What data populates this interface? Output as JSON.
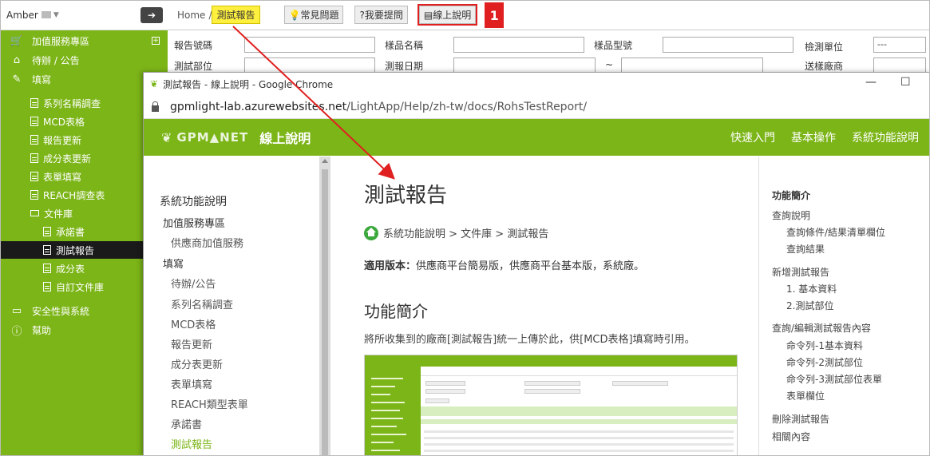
{
  "sidebar": {
    "user": "Amber",
    "items": [
      {
        "label": "加值服務專區",
        "icon": "cart-icon"
      },
      {
        "label": "待辦 / 公告",
        "icon": "home-icon"
      },
      {
        "label": "填寫",
        "icon": "edit-icon"
      },
      {
        "label": "系列名稱調查"
      },
      {
        "label": "MCD表格"
      },
      {
        "label": "報告更新"
      },
      {
        "label": "成分表更新"
      },
      {
        "label": "表單填寫"
      },
      {
        "label": "REACH調查表"
      },
      {
        "label": "文件庫"
      },
      {
        "label": "承諾書"
      },
      {
        "label": "測試報告"
      },
      {
        "label": "成分表"
      },
      {
        "label": "自訂文件庫"
      },
      {
        "label": "安全性與系統",
        "icon": "monitor-icon"
      },
      {
        "label": "幫助",
        "icon": "info-icon"
      }
    ]
  },
  "top": {
    "home": "Home",
    "sep": "/",
    "current": "測試報告",
    "faq": "常見問題",
    "ask": "我要提問",
    "help": "線上說明",
    "badge": "1"
  },
  "form": {
    "report_no": "報告號碼",
    "sample_name": "樣品名稱",
    "sample_model": "樣品型號",
    "test_unit": "檢測單位",
    "test_unit_value": "---",
    "test_part": "測試部位",
    "report_date": "測報日期",
    "tilde": "~",
    "send_factory": "送樣廠商"
  },
  "chrome": {
    "title": "測試報告 - 線上說明 - Google Chrome",
    "url_host": "gpmlight-lab.azurewebsites.net",
    "url_path": "/LightApp/Help/zh-tw/docs/RohsTestReport/"
  },
  "help": {
    "logo": "GPM▲NET",
    "title": "線上說明",
    "nav": [
      "快速入門",
      "基本操作",
      "系統功能說明"
    ],
    "left": {
      "heading": "系統功能說明",
      "items": [
        {
          "label": "加值服務專區",
          "kind": "group"
        },
        {
          "label": "供應商加值服務",
          "kind": "item"
        },
        {
          "label": "填寫",
          "kind": "group"
        },
        {
          "label": "待辦/公告",
          "kind": "item"
        },
        {
          "label": "系列名稱調查",
          "kind": "item"
        },
        {
          "label": "MCD表格",
          "kind": "item"
        },
        {
          "label": "報告更新",
          "kind": "item"
        },
        {
          "label": "成分表更新",
          "kind": "item"
        },
        {
          "label": "表單填寫",
          "kind": "item"
        },
        {
          "label": "REACH類型表單",
          "kind": "item"
        },
        {
          "label": "承諾書",
          "kind": "item"
        },
        {
          "label": "測試報告",
          "kind": "current"
        }
      ]
    },
    "main": {
      "title": "測試報告",
      "path": "系統功能說明 > 文件庫 > 測試報告",
      "ver_label": "適用版本：",
      "ver_value": "供應商平台簡易版，供應商平台基本版，系統廠。",
      "section": "功能簡介",
      "desc": "將所收集到的廠商[測試報告]統一上傳於此，供[MCD表格]填寫時引用。"
    },
    "right": [
      {
        "label": "功能簡介",
        "kind": "h"
      },
      {
        "label": "查詢說明",
        "kind": "a"
      },
      {
        "label": "查詢條件/結果清單欄位",
        "kind": "b"
      },
      {
        "label": "查詢結果",
        "kind": "b"
      },
      {
        "label": "新增測試報告",
        "kind": "a"
      },
      {
        "label": "1. 基本資料",
        "kind": "b"
      },
      {
        "label": "2.測試部位",
        "kind": "b"
      },
      {
        "label": "查詢/編輯測試報告內容",
        "kind": "a"
      },
      {
        "label": "命令列-1基本資料",
        "kind": "b"
      },
      {
        "label": "命令列-2測試部位",
        "kind": "b"
      },
      {
        "label": "命令列-3測試部位表單",
        "kind": "b"
      },
      {
        "label": "表單欄位",
        "kind": "b"
      },
      {
        "label": "刪除測試報告",
        "kind": "a"
      },
      {
        "label": "相關內容",
        "kind": "a"
      }
    ]
  },
  "colors": {
    "brand": "#7cb518",
    "highlight": "#ffef3f",
    "annotation": "#e02020"
  }
}
